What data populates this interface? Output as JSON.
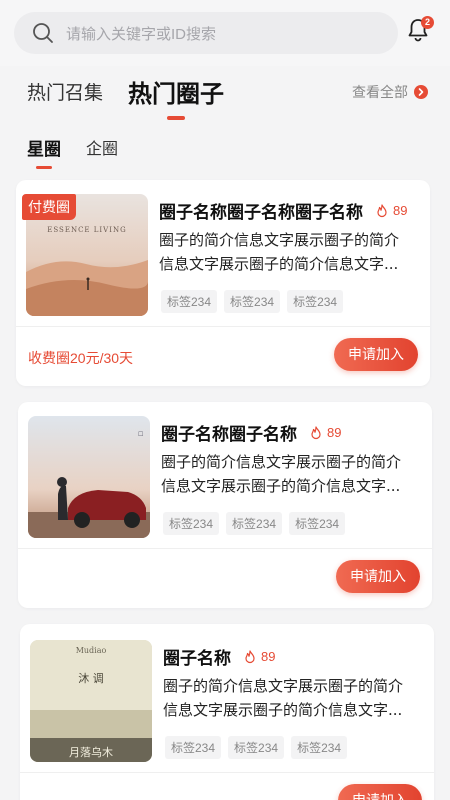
{
  "search": {
    "placeholder": "请输入关键字或ID搜索"
  },
  "notifications": {
    "count": "2"
  },
  "main_tabs": [
    {
      "label": "热门召集",
      "active": false
    },
    {
      "label": "热门圈子",
      "active": true
    }
  ],
  "view_all": {
    "label": "查看全部"
  },
  "sub_tabs": [
    {
      "label": "星圈",
      "active": true
    },
    {
      "label": "企圈",
      "active": false
    }
  ],
  "cards": [
    {
      "badge": "付费圈",
      "title": "圈子名称圈子名称圈子名称",
      "heat": "89",
      "desc_line1": "圈子的简介信息文字展示圈子的简介",
      "desc_line2": "信息文字展示圈子的简介信息文字...",
      "tags": [
        "标签234",
        "标签234",
        "标签234"
      ],
      "price": "收费圈20元/30天",
      "button": "申请加入",
      "image_text": "ESSENCE LIVING"
    },
    {
      "title": "圈子名称圈子名称",
      "heat": "89",
      "desc_line1": "圈子的简介信息文字展示圈子的简介",
      "desc_line2": "信息文字展示圈子的简介信息文字...",
      "tags": [
        "标签234",
        "标签234",
        "标签234"
      ],
      "button": "申请加入"
    },
    {
      "title": "圈子名称",
      "heat": "89",
      "desc_line1": "圈子的简介信息文字展示圈子的简介",
      "desc_line2": "信息文字展示圈子的简介信息文字...",
      "tags": [
        "标签234",
        "标签234",
        "标签234"
      ],
      "button": "申请加入",
      "image_text_1": "Mudiao",
      "image_text_2": "沐 调",
      "image_text_3": "月落乌木"
    }
  ],
  "colors": {
    "accent": "#e64b35",
    "tag_bg": "#f3f3f4",
    "page_bg": "#f4f4f5"
  }
}
